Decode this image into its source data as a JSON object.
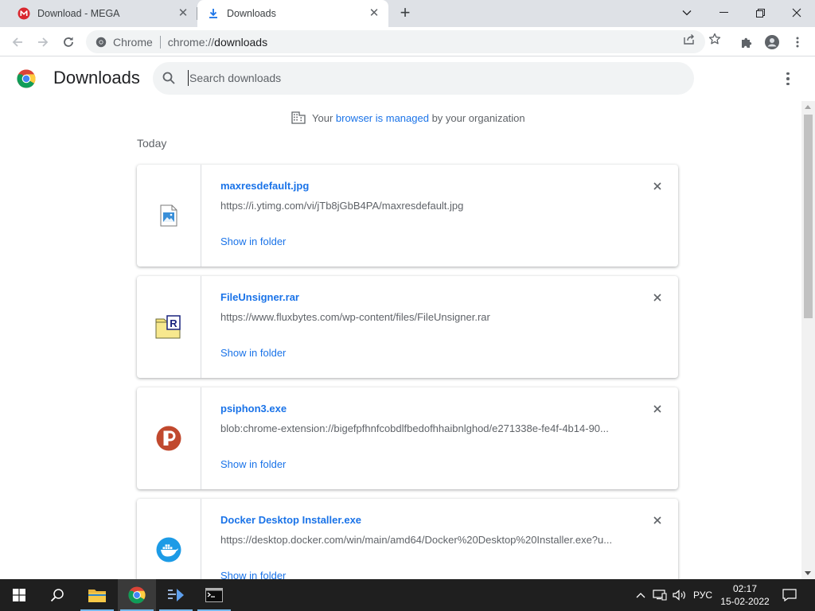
{
  "tabs": [
    {
      "title": "Download - MEGA",
      "favicon": "mega-icon"
    },
    {
      "title": "Downloads",
      "favicon": "download-icon"
    }
  ],
  "window_controls": [
    "chevron-down-icon",
    "minimize-icon",
    "restore-icon",
    "close-icon"
  ],
  "omnibox": {
    "chip": "Chrome",
    "url_scheme": "chrome://",
    "url_host": "downloads"
  },
  "page": {
    "title": "Downloads",
    "search_placeholder": "Search downloads",
    "managed": {
      "prefix": "Your ",
      "link": "browser is managed",
      "suffix": " by your organization"
    },
    "date_header": "Today"
  },
  "downloads": [
    {
      "name": "maxresdefault.jpg",
      "url": "https://i.ytimg.com/vi/jTb8jGbB4PA/maxresdefault.jpg",
      "action": "Show in folder",
      "icon": "image-file-icon"
    },
    {
      "name": "FileUnsigner.rar",
      "url": "https://www.fluxbytes.com/wp-content/files/FileUnsigner.rar",
      "action": "Show in folder",
      "icon": "rar-archive-icon"
    },
    {
      "name": "psiphon3.exe",
      "url": "blob:chrome-extension://bigefpfhnfcobdlfbedofhhaibnlghod/e271338e-fe4f-4b14-90...",
      "action": "Show in folder",
      "icon": "psiphon-icon"
    },
    {
      "name": "Docker Desktop Installer.exe",
      "url": "https://desktop.docker.com/win/main/amd64/Docker%20Desktop%20Installer.exe?u...",
      "action": "Show in folder",
      "icon": "docker-icon"
    }
  ],
  "taskbar": {
    "lang": "РУС",
    "time": "02:17",
    "date": "15-02-2022"
  },
  "colors": {
    "accent": "#1a73e8",
    "tabstrip": "#dee1e6",
    "taskbar": "#1f1f1f"
  }
}
